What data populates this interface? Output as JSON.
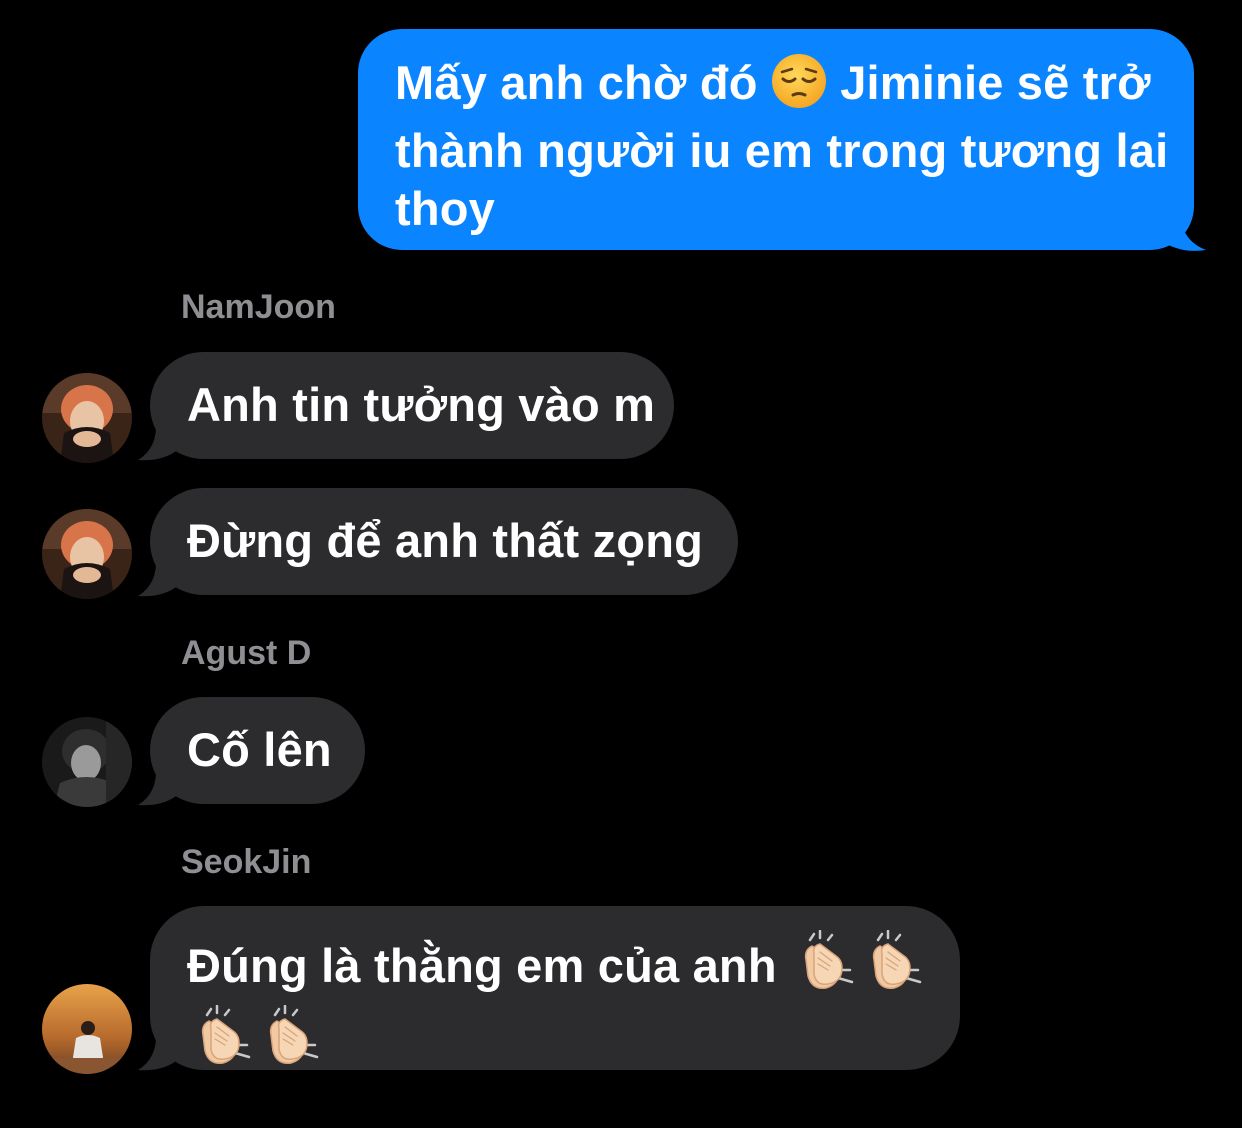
{
  "outgoing": {
    "text_before": "Mấy anh chờ đó",
    "emoji": "pensive-face",
    "text_after": "Jiminie sẽ trở thành người iu em trong tương lai thoy",
    "color": "#0a84ff"
  },
  "incoming_color": "#2c2c2e",
  "groups": [
    {
      "sender": "NamJoon",
      "messages": [
        {
          "text": "Anh tin tưởng vào m"
        },
        {
          "text": "Đừng để anh thất zọng"
        }
      ]
    },
    {
      "sender": "Agust D",
      "messages": [
        {
          "text": "Cố lên"
        }
      ]
    },
    {
      "sender": "SeokJin",
      "messages": [
        {
          "text": "Đúng là thằng em của anh",
          "emoji": "clapping-hands",
          "emoji_count": 4
        }
      ]
    }
  ]
}
